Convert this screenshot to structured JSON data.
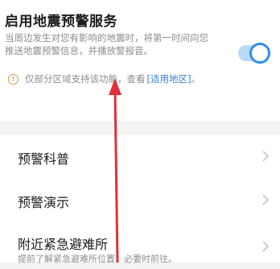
{
  "header": {
    "title": "启用地震预警服务",
    "description_line1": "当周边发生对您有影响的地震时，将第一时间向您",
    "description_line2": "推送地震预警信息，并播放警报音。",
    "toggle_state": "on",
    "accent_color": "#2e8df2"
  },
  "notice": {
    "icon": "info-circle-icon",
    "text": "仅部分区域支持该功能，查看",
    "link_text": "[适用地区]",
    "suffix": "。"
  },
  "menu": {
    "items": [
      {
        "label": "预警科普"
      },
      {
        "label": "预警演示"
      },
      {
        "label": "附近紧急避难所",
        "sublabel": "提前了解紧急避难所位置，必要时前往。"
      }
    ]
  },
  "annotation": {
    "arrow_color": "#e0303a"
  }
}
